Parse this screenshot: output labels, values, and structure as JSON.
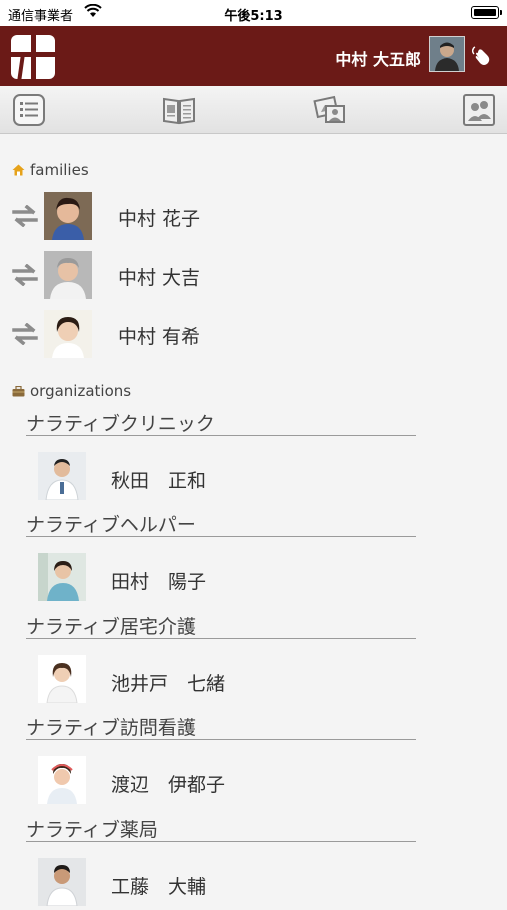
{
  "status_bar": {
    "carrier": "通信事業者",
    "time": "午後5:13"
  },
  "header": {
    "user_name": "中村 大五郎",
    "logo_icon": "app-logo-icon",
    "wave_icon": "waving-hand-icon"
  },
  "toolbar": {
    "tabs": [
      {
        "icon": "list-icon"
      },
      {
        "icon": "book-icon"
      },
      {
        "icon": "photo-album-icon"
      },
      {
        "icon": "contacts-icon"
      }
    ]
  },
  "families": {
    "title": "families",
    "members": [
      {
        "name": "中村 花子"
      },
      {
        "name": "中村 大吉"
      },
      {
        "name": "中村 有希"
      }
    ]
  },
  "organizations": {
    "title": "organizations",
    "items": [
      {
        "org_name": "ナラティブクリニック",
        "staff_name": "秋田　正和"
      },
      {
        "org_name": "ナラティブヘルパー",
        "staff_name": "田村　陽子"
      },
      {
        "org_name": "ナラティブ居宅介護",
        "staff_name": "池井戸　七緒"
      },
      {
        "org_name": "ナラティブ訪問看護",
        "staff_name": "渡辺　伊都子"
      },
      {
        "org_name": "ナラティブ薬局",
        "staff_name": "工藤　大輔"
      }
    ]
  },
  "colors": {
    "header_bg": "#6b1a17",
    "page_bg": "#f4f4f4"
  }
}
